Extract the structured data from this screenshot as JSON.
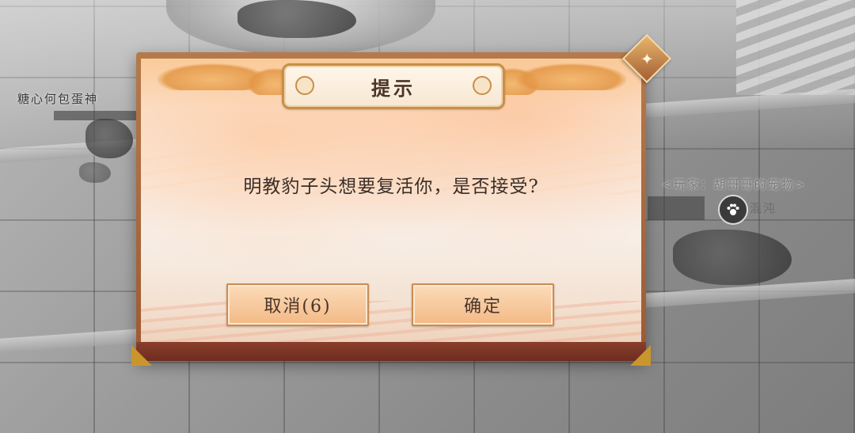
{
  "scene": {
    "npc_name": "糖心何包蛋神",
    "pet_owner_label": "<玩家：胡哥哥的宠物>",
    "pet_name": "混沌",
    "pet_icon": "paw-icon"
  },
  "dialog": {
    "title": "提示",
    "message": "明教豹子头想要复活你，是否接受?",
    "cancel_label": "取消(6)",
    "confirm_label": "确定",
    "close_icon": "decorative-diamond-icon"
  },
  "colors": {
    "frame": "#9c5a33",
    "paper": "#f8f0ea",
    "button": "#f7caa0",
    "text": "#3b2d26"
  }
}
